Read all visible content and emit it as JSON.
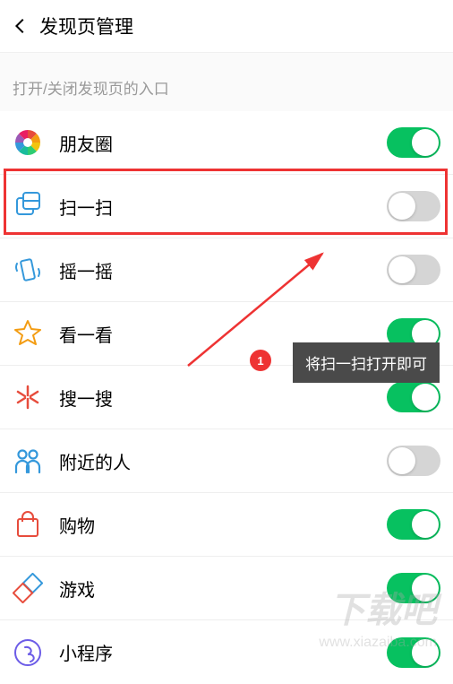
{
  "header": {
    "title": "发现页管理"
  },
  "section_label": "打开/关闭发现页的入口",
  "items": [
    {
      "label": "朋友圈",
      "enabled": true,
      "icon": "moments"
    },
    {
      "label": "扫一扫",
      "enabled": false,
      "icon": "scan"
    },
    {
      "label": "摇一摇",
      "enabled": false,
      "icon": "shake"
    },
    {
      "label": "看一看",
      "enabled": true,
      "icon": "look"
    },
    {
      "label": "搜一搜",
      "enabled": true,
      "icon": "search"
    },
    {
      "label": "附近的人",
      "enabled": false,
      "icon": "nearby"
    },
    {
      "label": "购物",
      "enabled": true,
      "icon": "shop"
    },
    {
      "label": "游戏",
      "enabled": true,
      "icon": "game"
    },
    {
      "label": "小程序",
      "enabled": true,
      "icon": "miniprogram"
    }
  ],
  "annotation": {
    "badge_number": "1",
    "tooltip_text": "将扫一扫打开即可",
    "highlight_item_index": 1
  },
  "watermarks": {
    "text_zh": "下载吧",
    "text_url": "www.xiazaiba.com"
  },
  "colors": {
    "toggle_on": "#07c160",
    "toggle_off": "#d5d5d5",
    "highlight": "#e33",
    "tooltip_bg": "#4a4a4a"
  }
}
